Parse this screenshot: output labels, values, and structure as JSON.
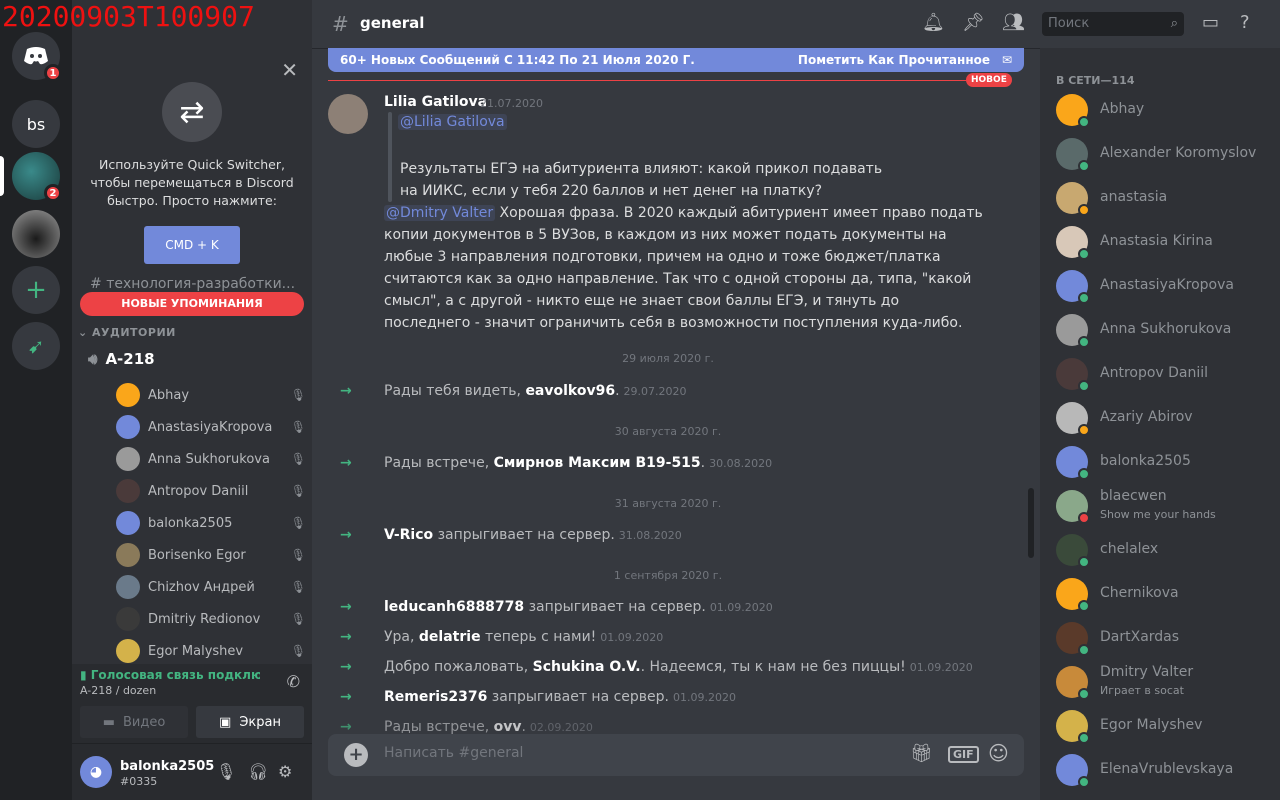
{
  "watermark": "20200903T100907",
  "colors": {
    "blurple": "#7289da",
    "red": "#ed4245",
    "green": "#43b581"
  },
  "guilds": {
    "home_badge": "1",
    "g2_label": "bs",
    "g3_badge": "2"
  },
  "quick_switcher": {
    "text": "Используйте Quick Switcher, чтобы перемещаться в Discord быстро. Просто нажмите:",
    "shortcut": "CMD + K"
  },
  "sidebar": {
    "faded_channel": "технология-разработки...",
    "new_mentions": "НОВЫЕ УПОМИНАНИЯ",
    "category": "АУДИТОРИИ",
    "voice_channel": "A-218",
    "voice_users": [
      {
        "name": "Abhay",
        "color": "#faa61a"
      },
      {
        "name": "AnastasiyaKropova",
        "color": "#7289da"
      },
      {
        "name": "Anna Sukhorukova",
        "color": "#9a9a9a"
      },
      {
        "name": "Antropov Daniil",
        "color": "#4a3a3a"
      },
      {
        "name": "balonka2505",
        "color": "#7289da"
      },
      {
        "name": "Borisenko Egor",
        "color": "#8a7a5a"
      },
      {
        "name": "Chizhov Андрей",
        "color": "#6a7a8a"
      },
      {
        "name": "Dmitriy Redionov",
        "color": "#3a3a3a"
      },
      {
        "name": "Egor Malyshev",
        "color": "#d4b24a"
      }
    ],
    "voice_status": "Голосовая связь подключ",
    "voice_location": "A-218 / dozen",
    "video_label": "Видео",
    "screen_label": "Экран",
    "user_name": "balonka2505",
    "user_tag": "#0335"
  },
  "header": {
    "channel": "general",
    "search_placeholder": "Поиск"
  },
  "new_messages": {
    "text": "60+ Новых Сообщений С 11:42 По 21 Июля 2020 Г.",
    "mark_read": "Пометить Как Прочитанное",
    "new_tag": "НОВОЕ"
  },
  "message": {
    "author": "Lilia Gatilova",
    "timestamp": "21.07.2020",
    "quote_mention": "@Lilia Gatilova",
    "quote_text": "Результаты ЕГЭ на абитуриента влияют: какой прикол подавать на ИИКС, если у тебя 220 баллов и нет денег на платку?",
    "reply_mention": "@Dmitry Valter",
    "reply_text": " Хорошая фраза. В 2020 каждый абитуриент имеет право подать копии документов в 5 ВУЗов, в каждом из них может подать документы на любые 3 направления подготовки, причем на одно и тоже бюджет/платка считаются как за одно направление. Так что с одной стороны да, типа, \"какой смысл\", а с другой - никто еще не знает свои баллы ЕГЭ, и тянуть до последнего - значит ограничить себя в возможности поступления куда-либо."
  },
  "feed": {
    "d1": "29 июля 2020 г.",
    "j1": {
      "pre": "Рады тебя видеть, ",
      "name": "eavolkov96",
      "post": ".",
      "time": "29.07.2020"
    },
    "d2": "30 августа 2020 г.",
    "j2": {
      "pre": "Рады встрече, ",
      "name": "Смирнов Максим В19-515",
      "post": ".",
      "time": "30.08.2020"
    },
    "d3": "31 августа 2020 г.",
    "j3": {
      "pre": "",
      "name": "V-Rico",
      "post": " запрыгивает на сервер.",
      "time": "31.08.2020"
    },
    "d4": "1 сентября 2020 г.",
    "j4": {
      "pre": "",
      "name": "leducanh6888778",
      "post": " запрыгивает на сервер.",
      "time": "01.09.2020"
    },
    "j5": {
      "pre": "Ура, ",
      "name": "delatrie",
      "post": " теперь с нами!",
      "time": "01.09.2020"
    },
    "j6": {
      "pre": "Добро пожаловать, ",
      "name": "Schukina O.V.",
      "post": ". Надеемся, ты к нам не без пиццы!",
      "time": "01.09.2020"
    },
    "j7": {
      "pre": "",
      "name": "Remeris2376",
      "post": " запрыгивает на сервер.",
      "time": "01.09.2020"
    },
    "j8": {
      "pre": "Рады встрече, ",
      "name": "ovv",
      "post": ".",
      "time": "02.09.2020"
    }
  },
  "composer": {
    "placeholder": "Написать #general",
    "gif": "GIF"
  },
  "members": {
    "header": "В СЕТИ—114",
    "list": [
      {
        "name": "Abhay",
        "color": "#faa61a",
        "status": "#43b581",
        "sub": ""
      },
      {
        "name": "Alexander Koromyslov",
        "color": "#5a6a6a",
        "status": "#43b581",
        "sub": ""
      },
      {
        "name": "anastasia",
        "color": "#c8a870",
        "status": "#faa61a",
        "sub": ""
      },
      {
        "name": "Anastasia Kirina",
        "color": "#d8c8b8",
        "status": "#43b581",
        "sub": ""
      },
      {
        "name": "AnastasiyaKropova",
        "color": "#7289da",
        "status": "#43b581",
        "sub": ""
      },
      {
        "name": "Anna Sukhorukova",
        "color": "#9a9a9a",
        "status": "#43b581",
        "sub": ""
      },
      {
        "name": "Antropov Daniil",
        "color": "#4a3a3a",
        "status": "#43b581",
        "sub": ""
      },
      {
        "name": "Azariy Abirov",
        "color": "#b8b8b8",
        "status": "#faa61a",
        "sub": ""
      },
      {
        "name": "balonka2505",
        "color": "#7289da",
        "status": "#43b581",
        "sub": ""
      },
      {
        "name": "blaecwen",
        "color": "#8aa88a",
        "status": "#ed4245",
        "sub": "Show me your hands"
      },
      {
        "name": "chelalex",
        "color": "#3a4a3a",
        "status": "#43b581",
        "sub": ""
      },
      {
        "name": "Chernikova",
        "color": "#faa61a",
        "status": "#43b581",
        "sub": ""
      },
      {
        "name": "DartXardas",
        "color": "#5a3a2a",
        "status": "#43b581",
        "sub": ""
      },
      {
        "name": "Dmitry Valter",
        "color": "#c88a3a",
        "status": "#43b581",
        "sub": "Играет в socat"
      },
      {
        "name": "Egor Malyshev",
        "color": "#d4b24a",
        "status": "#43b581",
        "sub": ""
      },
      {
        "name": "ElenaVrublevskaya",
        "color": "#7289da",
        "status": "#43b581",
        "sub": ""
      }
    ]
  }
}
